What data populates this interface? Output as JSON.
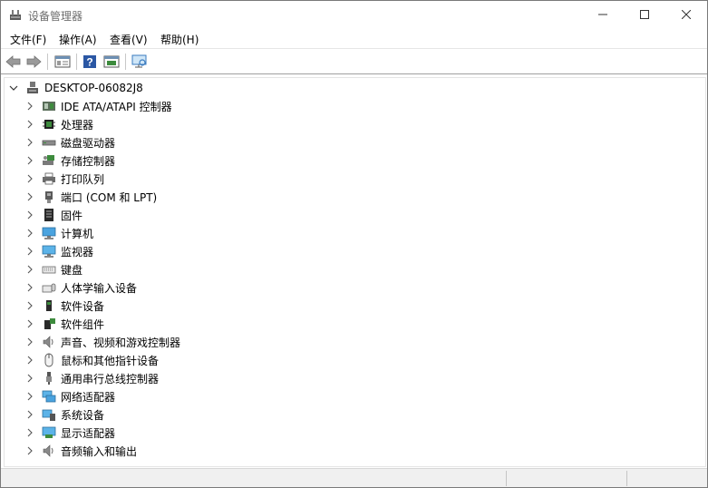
{
  "window": {
    "title": "设备管理器",
    "accent": "#2e7d32"
  },
  "menu": {
    "file": "文件(F)",
    "action": "操作(A)",
    "view": "查看(V)",
    "help": "帮助(H)"
  },
  "toolbar": {
    "icons": [
      "back-arrow-icon",
      "forward-arrow-icon",
      "properties-icon",
      "help-icon",
      "update-driver-icon",
      "scan-hardware-icon"
    ]
  },
  "tree": {
    "root": "DESKTOP-06082J8",
    "items": [
      {
        "label": "IDE ATA/ATAPI 控制器",
        "icon": "ide-controller-icon"
      },
      {
        "label": "处理器",
        "icon": "processor-icon"
      },
      {
        "label": "磁盘驱动器",
        "icon": "disk-drive-icon"
      },
      {
        "label": "存储控制器",
        "icon": "storage-controller-icon"
      },
      {
        "label": "打印队列",
        "icon": "printer-icon"
      },
      {
        "label": "端口 (COM 和 LPT)",
        "icon": "port-icon"
      },
      {
        "label": "固件",
        "icon": "firmware-icon"
      },
      {
        "label": "计算机",
        "icon": "computer-icon"
      },
      {
        "label": "监视器",
        "icon": "monitor-icon"
      },
      {
        "label": "键盘",
        "icon": "keyboard-icon"
      },
      {
        "label": "人体学输入设备",
        "icon": "hid-icon"
      },
      {
        "label": "软件设备",
        "icon": "software-device-icon"
      },
      {
        "label": "软件组件",
        "icon": "software-component-icon"
      },
      {
        "label": "声音、视频和游戏控制器",
        "icon": "sound-icon"
      },
      {
        "label": "鼠标和其他指针设备",
        "icon": "mouse-icon"
      },
      {
        "label": "通用串行总线控制器",
        "icon": "usb-icon"
      },
      {
        "label": "网络适配器",
        "icon": "network-adapter-icon"
      },
      {
        "label": "系统设备",
        "icon": "system-device-icon"
      },
      {
        "label": "显示适配器",
        "icon": "display-adapter-icon"
      },
      {
        "label": "音频输入和输出",
        "icon": "audio-io-icon"
      }
    ]
  }
}
